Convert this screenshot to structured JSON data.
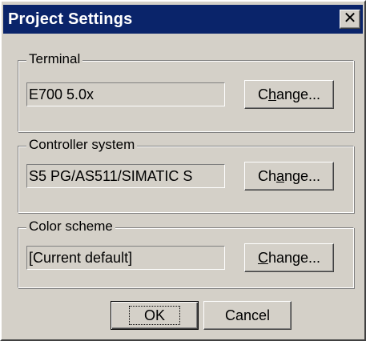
{
  "window": {
    "title": "Project Settings",
    "close_label": "✕"
  },
  "groups": {
    "terminal": {
      "legend": "Terminal",
      "value": "E700 5.0x",
      "button_label": "Change...",
      "button_accesskey": "h"
    },
    "controller": {
      "legend": "Controller system",
      "value": "S5 PG/AS511/SIMATIC S",
      "button_label": "Change...",
      "button_accesskey": "a"
    },
    "color_scheme": {
      "legend": "Color scheme",
      "value": "[Current default]",
      "button_label": "Change...",
      "button_accesskey": "C"
    }
  },
  "footer": {
    "ok_label": "OK",
    "cancel_label": "Cancel"
  },
  "colors": {
    "titlebar": "#0a246a",
    "face": "#d4d0c8"
  }
}
